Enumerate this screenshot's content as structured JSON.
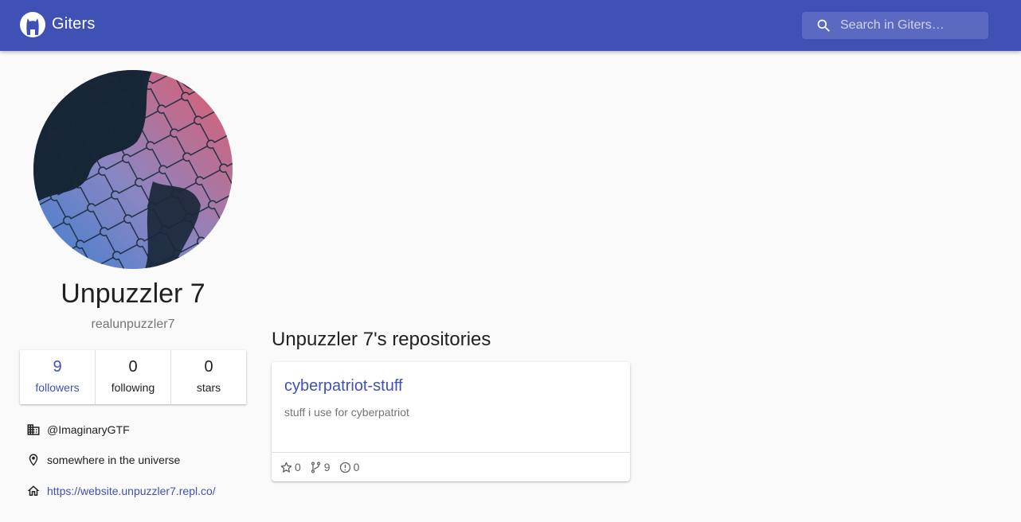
{
  "app": {
    "name": "Giters",
    "logo_icon": "octocat-silhouette-icon",
    "accent": "#3f51b5"
  },
  "search": {
    "placeholder": "Search in Giters…",
    "icon": "search-icon"
  },
  "profile": {
    "name": "Unpuzzler 7",
    "login": "realunpuzzler7",
    "avatar": "puzzle-pieces-gradient-avatar",
    "stats": [
      {
        "value": "9",
        "label": "followers"
      },
      {
        "value": "0",
        "label": "following"
      },
      {
        "value": "0",
        "label": "stars"
      }
    ],
    "company": "@ImaginaryGTF",
    "location": "somewhere in the universe",
    "website": "https://website.unpuzzler7.repl.co/"
  },
  "repositories": {
    "title": "Unpuzzler 7's repositories",
    "items": [
      {
        "name": "cyberpatriot-stuff",
        "description": "stuff i use for cyberpatriot",
        "stars": "0",
        "forks": "9",
        "issues": "0"
      }
    ]
  }
}
